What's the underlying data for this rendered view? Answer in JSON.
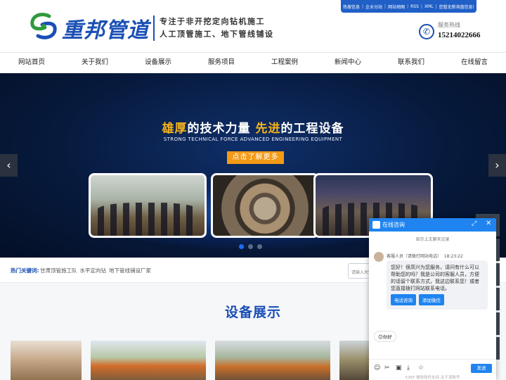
{
  "top_links": [
    "热搜信息",
    "企业分站",
    "网站地图",
    "RSS",
    "XML",
    "您暂无新询盘信息!"
  ],
  "header": {
    "logo_text": "重邦管道",
    "slogan_line1": "专注于非开挖定向钻机施工",
    "slogan_line2": "人工顶管施工、地下管线铺设",
    "hotline_label": "服务热线",
    "hotline_number": "15214022666"
  },
  "nav": {
    "items": [
      "网站首页",
      "关于我们",
      "设备展示",
      "服务项目",
      "工程案例",
      "新闻中心",
      "联系我们",
      "在线留言"
    ]
  },
  "banner": {
    "title_part1": "雄厚",
    "title_part2": "的技术力量 ",
    "title_part3": "先进",
    "title_part4": "的工程设备",
    "subtitle": "STRONG TECHNICAL FORCE ADVANCED ENGINEERING EQUIPMENT",
    "cta_label": "点击了解更多",
    "prev_label": "‹",
    "next_label": "›",
    "active_slide": 1,
    "slide_count": 3
  },
  "hot_keywords": {
    "label": "热门关键词:",
    "items": [
      "甘肃顶管施工队",
      "水平定向钻",
      "地下管线铺设厂家"
    ],
    "search_placeholder": "请输入关键词"
  },
  "equipment": {
    "title": "设备展示"
  },
  "chat": {
    "title": "在线咨询",
    "history_link": "显示上文聊天记录",
    "agent_name": "客服人员（请拨打网站电话）",
    "time": "18:23:22",
    "message": "您好！很高兴为您服务，请问有什么可以帮助您的吗？我是公司的客服人员，方便的话留个联系方式，我这边联系您！或者您直接拨打网站联系电话。",
    "btn_phone": "电话咨询",
    "btn_wechat": "添加微信",
    "quick_reply": "😊你好",
    "send_label": "发送",
    "footer": "53KF 微软软件支持  关于该账号"
  },
  "colors": {
    "brand_blue": "#1a4fb5",
    "accent_orange": "#f39a16",
    "chat_blue": "#1f84ef"
  }
}
